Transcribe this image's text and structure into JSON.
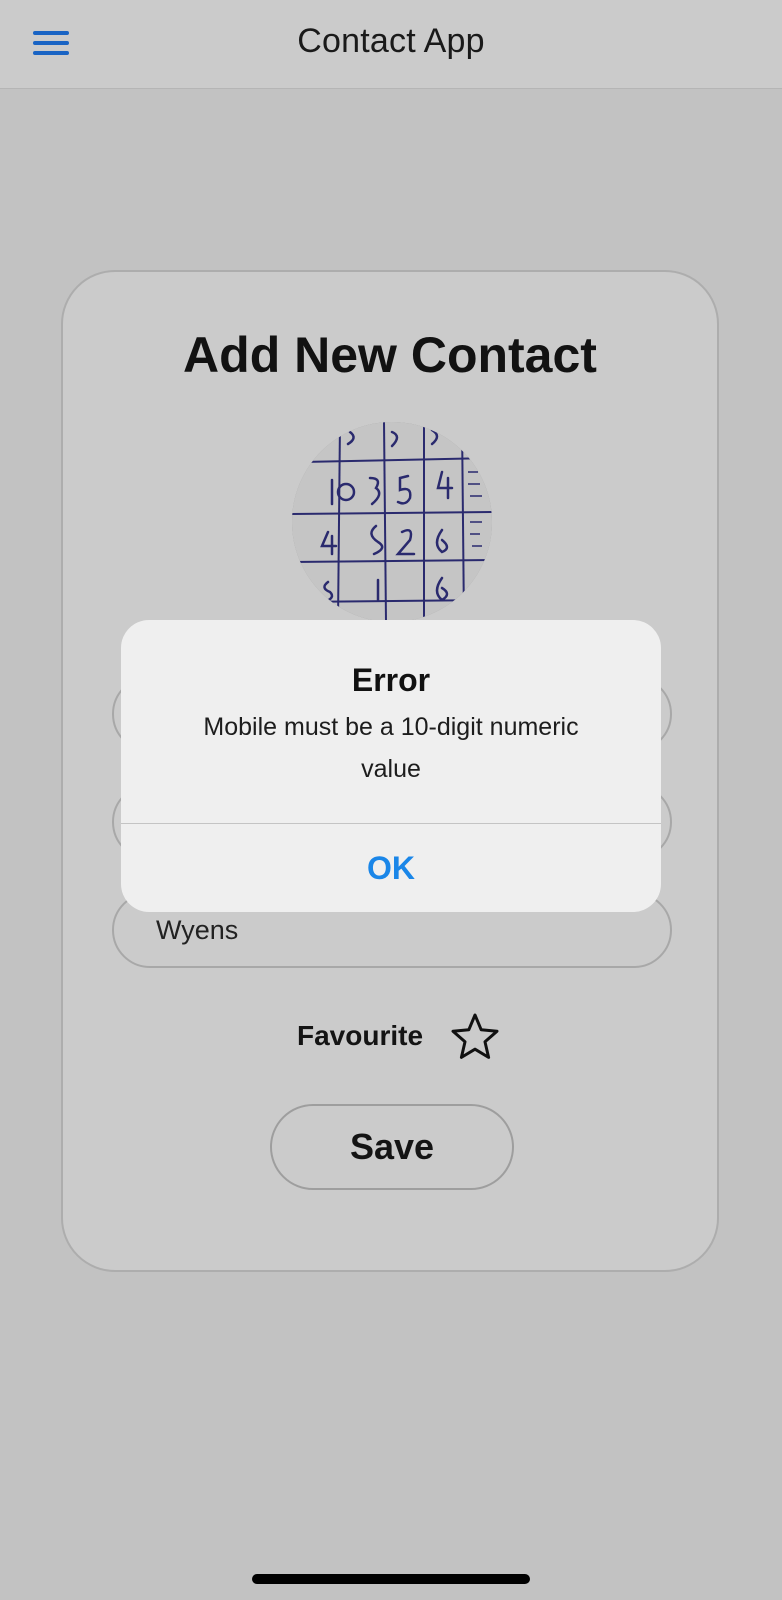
{
  "navbar": {
    "title": "Contact App",
    "menu_icon": "hamburger-menu-icon"
  },
  "form": {
    "title": "Add New Contact",
    "fields": [
      {
        "value": ""
      },
      {
        "value": ""
      },
      {
        "value": "Wyens"
      }
    ],
    "favourite_label": "Favourite",
    "favourite_icon": "star-outline-icon",
    "favourite_checked": false,
    "save_label": "Save"
  },
  "alert": {
    "title": "Error",
    "message": "Mobile must be a 10-digit numeric value",
    "ok_label": "OK"
  },
  "colors": {
    "accent": "#1a64c4",
    "alert_button": "#1a86e8",
    "background": "#c2c2c2"
  }
}
